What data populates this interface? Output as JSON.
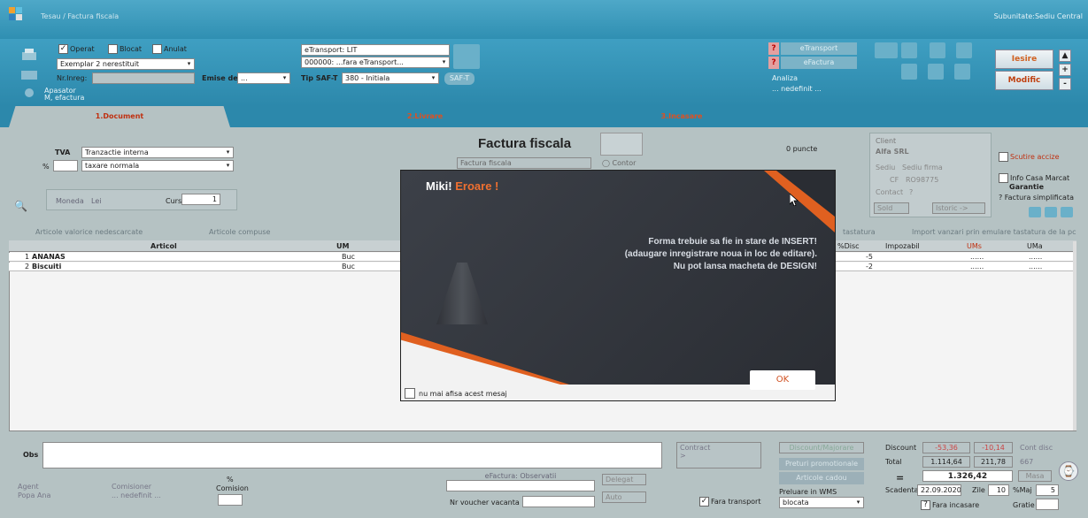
{
  "window": {
    "title": "Tesau / Factura fiscala",
    "subunit": "Subunitate:Sediu Central"
  },
  "toolbar": {
    "operat": "Operat",
    "blocat": "Blocat",
    "anulat": "Anulat",
    "exemplar": "Exemplar 2 nerestituit",
    "nr_inreg_label": "Nr.Inreg:",
    "emise_de_label": "Emise de",
    "emise_de_value": "...",
    "apasator": "Apasator",
    "apasator2": "M, efactura",
    "etransport_label": "eTransport: LIT",
    "etransport_value": "000000: ...fara eTransport...",
    "tip_saft_label": "Tip SAF-T",
    "tip_saft_value": "380 - Initiala",
    "saft_btn": "SAF-T",
    "q1": "?",
    "q2": "?",
    "etransport_btn": "eTransport",
    "efactura_btn": "eFactura",
    "analiza": "Analiza",
    "analiza2": "... nedefinit ...",
    "iesire": "Iesire",
    "modific": "Modific",
    "plus": "+",
    "minus": "-"
  },
  "tabs": [
    "1.Document",
    "2.Livrare",
    "3.Incasare"
  ],
  "document": {
    "tva_label": "TVA",
    "tva_value": "Tranzactie interna",
    "pct_label": "%",
    "taxare_value": "taxare normala",
    "moneda_label": "Moneda",
    "moneda_value": "Lei",
    "curs_label": "Curs",
    "curs_value": "1",
    "heading": "Factura fiscala",
    "subheading": "Factura fiscala",
    "contor": "Contor",
    "puncte": "0 puncte",
    "client_label": "Client",
    "client_value": "Alfa SRL",
    "sediu_label": "Sediu",
    "sediu_value": "Sediu firma",
    "cf_label": "CF",
    "cf_value": "RO98775",
    "contact_label": "Contact",
    "contact_value": "?",
    "sold_label": "Sold",
    "sold_value": "Istoric ->",
    "scutire": "Scutire accize",
    "info_casa": "Info Casa Marcat",
    "garantie": "Garantie",
    "factura_simpl": "? Factura simplificata",
    "articole_valorice": "Articole valorice nedescarcate",
    "articole_compuse": "Articole compuse",
    "tastatura": "tastatura",
    "import_vanzari": "Import vanzari prin emulare tastatura de la pc"
  },
  "grid": {
    "headers": [
      "Articol",
      "UM",
      "%Disc",
      "Impozabil",
      "UMs",
      "UMa"
    ],
    "rows": [
      {
        "no": "1",
        "articol": "ANANAS",
        "um": "Buc",
        "disc": "-5",
        "ums": "......",
        "uma": "......"
      },
      {
        "no": "2",
        "articol": "Biscuiti",
        "um": "Buc",
        "disc": "-2",
        "ums": "......",
        "uma": "......"
      }
    ]
  },
  "bottom": {
    "obs": "Obs",
    "contract": "Contract",
    "contract_val": ">",
    "agent_label": "Agent",
    "agent_value": "Popa Ana",
    "comisioner_label": "Comisioner",
    "comisioner_value": "... nedefinit ...",
    "comision_pct": "%",
    "comision_label": "Comision",
    "efactura_obs": "eFactura: Observatii",
    "nr_voucher": "Nr voucher vacanta",
    "delegat": "Delegat",
    "auto": "Auto",
    "fara_transport": "Fara transport",
    "discount_majorare": "Discount/Majorare",
    "preturi_promo": "Preturi promotionale",
    "articole_cadou": "Articole cadou",
    "preluare_wms": "Preluare in WMS",
    "preluare_value": "blocata",
    "discount_label": "Discount",
    "disc1": "-53,36",
    "disc2": "-10,14",
    "cont_disc": "Cont disc",
    "total_label": "Total",
    "total1": "1.114,64",
    "total2": "211,78",
    "total3": "667",
    "equals": "=",
    "grand_total": "1.326,42",
    "masa": "Masa",
    "scadenta_label": "Scadenta",
    "scadenta_value": "22.09.2020",
    "zile_label": "Zile",
    "zile_value": "10",
    "pct_majorare_label": "%Maj",
    "pct_majorare_value": "5",
    "fara_incasare": "Fara incasare",
    "gratie_label": "Gratie"
  },
  "dialog": {
    "title_name": "Miki!",
    "title_err": "Eroare !",
    "line1": "Forma trebuie sa fie in stare de INSERT!",
    "line2": "(adaugare inregistrare noua in loc de editare).",
    "line3": "Nu pot lansa macheta de DESIGN!",
    "ok": "OK",
    "no_show": "nu mai afisa acest mesaj"
  }
}
